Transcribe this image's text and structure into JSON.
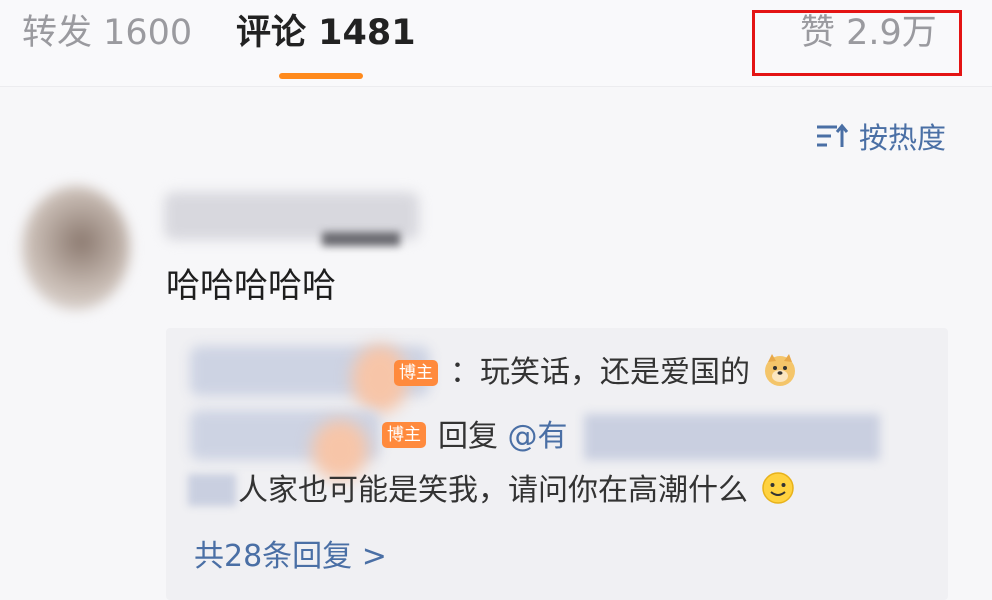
{
  "tabs": {
    "repost": "转发 1600",
    "comments": "评论 1481",
    "likes": "赞 2.9万"
  },
  "sort": {
    "label": "按热度",
    "icon": "sort-icon"
  },
  "comment": {
    "text": "哈哈哈哈哈"
  },
  "replies": [
    {
      "badge": "博主",
      "text": "：玩笑话，还是爱国的",
      "emoji": "doge-emoji"
    },
    {
      "badge": "博主",
      "prefix": "回复",
      "mention": "@有"
    },
    {
      "text": "人家也可能是笑我，请问你在高潮什么",
      "emoji": "smile-emoji"
    }
  ],
  "more_replies": "共28条回复 >",
  "colors": {
    "accent_orange": "#ff8a1c",
    "link_blue": "#4a6fa5",
    "highlight_red": "#e41414"
  }
}
